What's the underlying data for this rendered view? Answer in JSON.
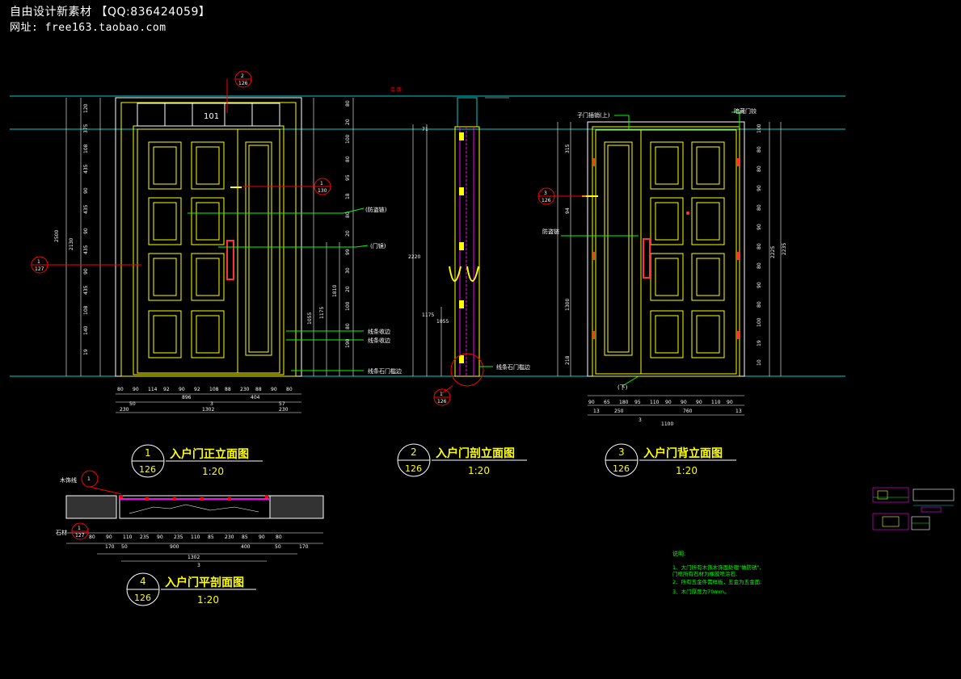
{
  "header": {
    "line1": "自由设计新素材  【QQ:836424059】",
    "line2": "网址: free163.taobao.com"
  },
  "colors": {
    "background": "#000000",
    "frame": "#ffffff",
    "door": "#ffff00",
    "dimension": "#ffffff",
    "leader": "#00ff00",
    "tag": "#ff0000",
    "guide": "#00cccc",
    "section": "#ff00ff"
  },
  "front_view": {
    "room_number": "101",
    "tag_top": {
      "num": "2",
      "sheet": "126"
    },
    "tag_handle": {
      "num": "1",
      "sheet": "130"
    },
    "tag_left": {
      "num": "1",
      "sheet": "127"
    },
    "notes": [
      "(防盗链)",
      "(门镜)",
      "线条收边",
      "线条收边",
      "线条石门槛边"
    ],
    "dims_left": [
      "120",
      "375",
      "108",
      "435",
      "90",
      "435",
      "90",
      "435",
      "90",
      "435",
      "108",
      "140",
      "19"
    ],
    "dims_left_total": [
      "2500",
      "2130"
    ],
    "dims_right": [
      "80",
      "20",
      "100",
      "80",
      "95",
      "18",
      "80",
      "20",
      "99",
      "30",
      "20",
      "100",
      "80",
      "190"
    ],
    "dims_right_total": [
      "1810",
      "1175",
      "1055"
    ],
    "dims_bottom_1": [
      "80",
      "90",
      "114",
      "92",
      "90",
      "92",
      "108",
      "88",
      "230",
      "88",
      "90",
      "80"
    ],
    "dims_bottom_2": [
      "896",
      "404"
    ],
    "dims_bottom_3": [
      "230",
      "1302",
      "230"
    ],
    "dims_bottom_extra": [
      "50",
      "3",
      "57"
    ]
  },
  "section_view": {
    "dims": [
      "71",
      "2220",
      "1175",
      "1055"
    ],
    "tag_bottom": {
      "num": "1",
      "sheet": "126"
    },
    "note": "线条石门槛边",
    "marker": "立 面"
  },
  "back_view": {
    "tag_left": {
      "num": "3",
      "sheet": "126"
    },
    "notes": [
      "子门插销(上)",
      "暗藏门铰",
      "防盗链",
      "(下)"
    ],
    "dims_left": [
      "315",
      "94",
      "1300",
      "218"
    ],
    "dims_right": [
      "100",
      "80",
      "80",
      "90",
      "80",
      "90",
      "80",
      "80",
      "90",
      "80",
      "100",
      "19",
      "10"
    ],
    "dims_right_total": [
      "2225",
      "2235"
    ],
    "dims_bottom_1": [
      "90",
      "65",
      "180",
      "95",
      "110",
      "90",
      "90",
      "90",
      "110",
      "90"
    ],
    "dims_bottom_2": [
      "13",
      "250",
      "760",
      "13"
    ],
    "dims_bottom_3": [
      "3",
      "1100"
    ]
  },
  "plan_view": {
    "tag_top": {
      "num": "1",
      "sheet": ""
    },
    "tag_bottom": {
      "num": "1",
      "sheet": "127"
    },
    "label_top": "木饰线",
    "label_bottom": "石材",
    "dims_1": [
      "80",
      "90",
      "110",
      "235",
      "90",
      "235",
      "110",
      "85",
      "230",
      "85",
      "90",
      "80"
    ],
    "dims_2": [
      "170",
      "50",
      "900",
      "400",
      "50",
      "170"
    ],
    "dims_3": [
      "1302"
    ],
    "dims_4": [
      "3"
    ]
  },
  "titles": [
    {
      "num": "1",
      "sheet": "126",
      "title": "入户门正立面图",
      "scale": "1:20"
    },
    {
      "num": "2",
      "sheet": "126",
      "title": "入户门剖立面图",
      "scale": "1:20"
    },
    {
      "num": "3",
      "sheet": "126",
      "title": "入户门背立面图",
      "scale": "1:20"
    },
    {
      "num": "4",
      "sheet": "126",
      "title": "入户门平剖面图",
      "scale": "1:20"
    }
  ],
  "notes_block": {
    "heading": "说明:",
    "lines": [
      "1、大门所有木饰木饰面处理\"做防锈\",",
      "    门框所有石材为橡胶喷涂石,",
      "2、所有五金件需样板，五金为五金面;",
      "3、木门厚度为70mm。"
    ]
  }
}
